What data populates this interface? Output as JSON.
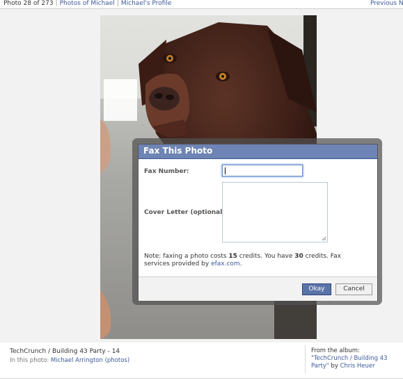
{
  "topbar": {
    "counter": "Photo 28 of 273",
    "links": [
      "Photos of Michael",
      "Michael's Profile"
    ],
    "previous": "Previous",
    "next": "Ne"
  },
  "dialog": {
    "title": "Fax This Photo",
    "fax_label": "Fax Number:",
    "fax_value": "",
    "cover_label": "Cover Letter (optional):",
    "cover_value": "",
    "note_pre": "Note: faxing a photo costs ",
    "note_cost": "15",
    "note_mid": " credits. You have ",
    "note_balance": "30",
    "note_post": " credits. Fax services provided by ",
    "note_link": "efax.com",
    "note_end": ".",
    "okay": "Okay",
    "cancel": "Cancel"
  },
  "caption": {
    "title": "TechCrunch / Building 43 Party - 14",
    "tags_prefix": "In this photo: ",
    "tagged_person": "Michael Arrington",
    "tagged_photos": "(photos)",
    "album_prefix": "From the album:",
    "album_name": "\"TechCrunch / Building 43 Party\"",
    "album_by": " by ",
    "album_author": "Chris Heuer"
  },
  "colors": {
    "accent": "#3b5998",
    "dialog_header": "#6d84b4",
    "okay_button": "#5b74a8"
  }
}
